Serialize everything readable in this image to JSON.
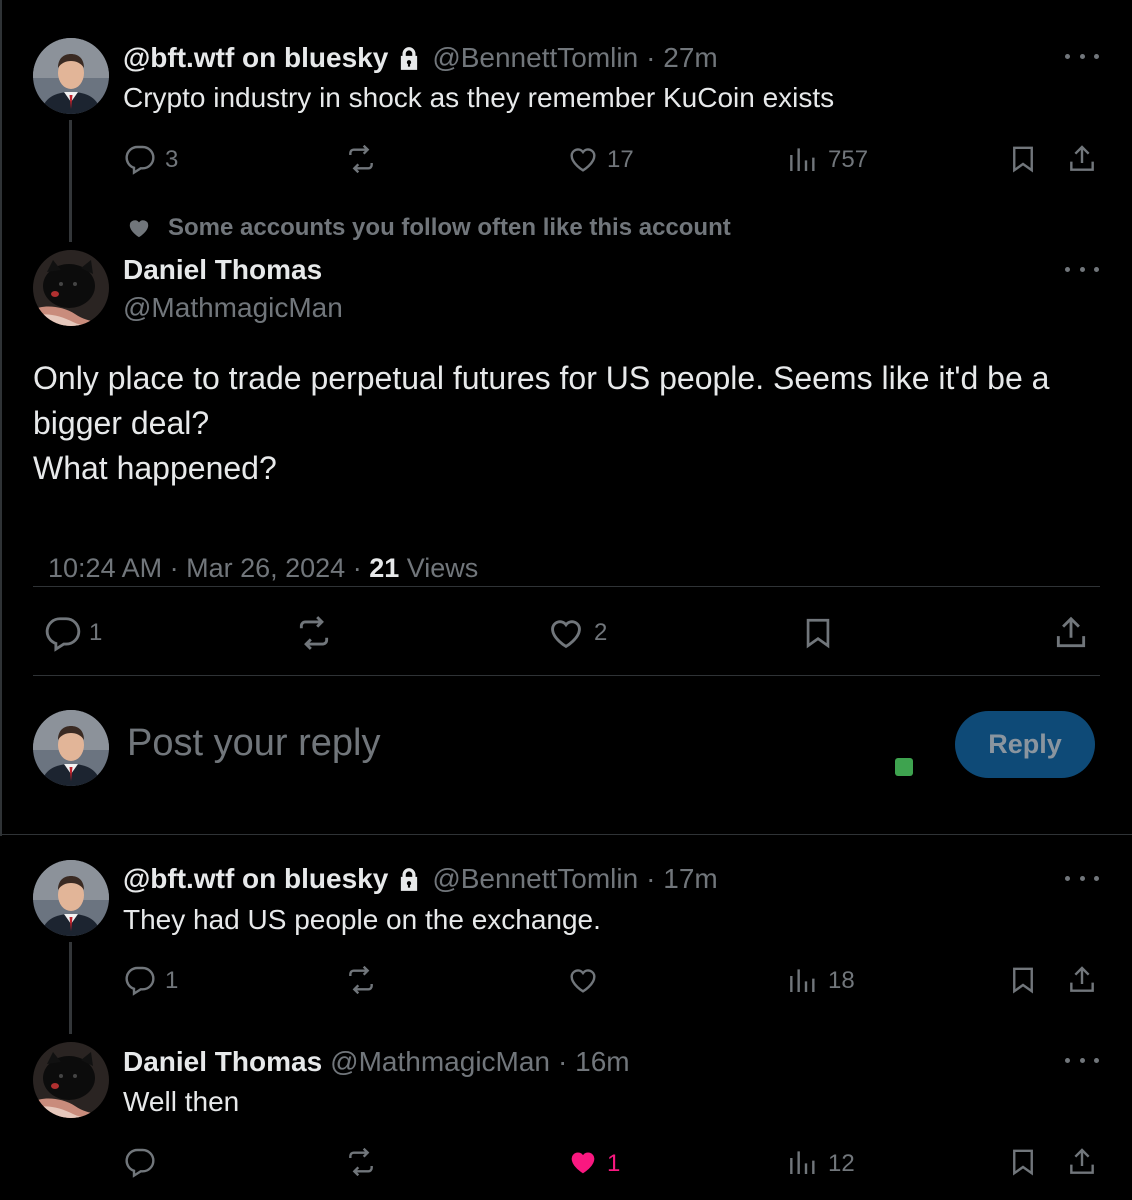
{
  "posts": [
    {
      "display_name": "@bft.wtf on bluesky",
      "handle": "@BennettTomlin",
      "time": "· 27m",
      "text": "Crypto industry in shock as they remember KuCoin exists",
      "replies": "3",
      "likes": "17",
      "views": "757"
    },
    {
      "social_context": "Some accounts you follow often like this account",
      "display_name": "Daniel Thomas",
      "handle": "@MathmagicMan",
      "text_lines": [
        "Only place to trade perpetual futures for US people.  Seems like it'd be a",
        "bigger deal?",
        "What happened?"
      ],
      "timestamp": "10:24 AM · Mar 26, 2024 · ",
      "views_count": "21",
      "views_label": " Views",
      "replies": "1",
      "likes": "2"
    },
    {
      "display_name": "@bft.wtf on bluesky",
      "handle": "@BennettTomlin",
      "time": "· 17m",
      "text": "They had US people on the exchange.",
      "replies": "1",
      "views": "18"
    },
    {
      "display_name": "Daniel Thomas",
      "handle": "@MathmagicMan",
      "time": "· 16m",
      "text": "Well then",
      "likes": "1",
      "views": "12"
    }
  ],
  "composer": {
    "placeholder": "Post your reply",
    "reply_label": "Reply"
  },
  "colors": {
    "background": "#000000",
    "text": "#e7e9ea",
    "muted": "#71767b",
    "like_active": "#f91880",
    "reply_button": "#1d9bf0"
  },
  "icons": [
    "lock-icon",
    "reply-icon",
    "retweet-icon",
    "like-icon",
    "views-icon",
    "bookmark-icon",
    "share-icon",
    "more-icon",
    "heart-small-icon"
  ]
}
